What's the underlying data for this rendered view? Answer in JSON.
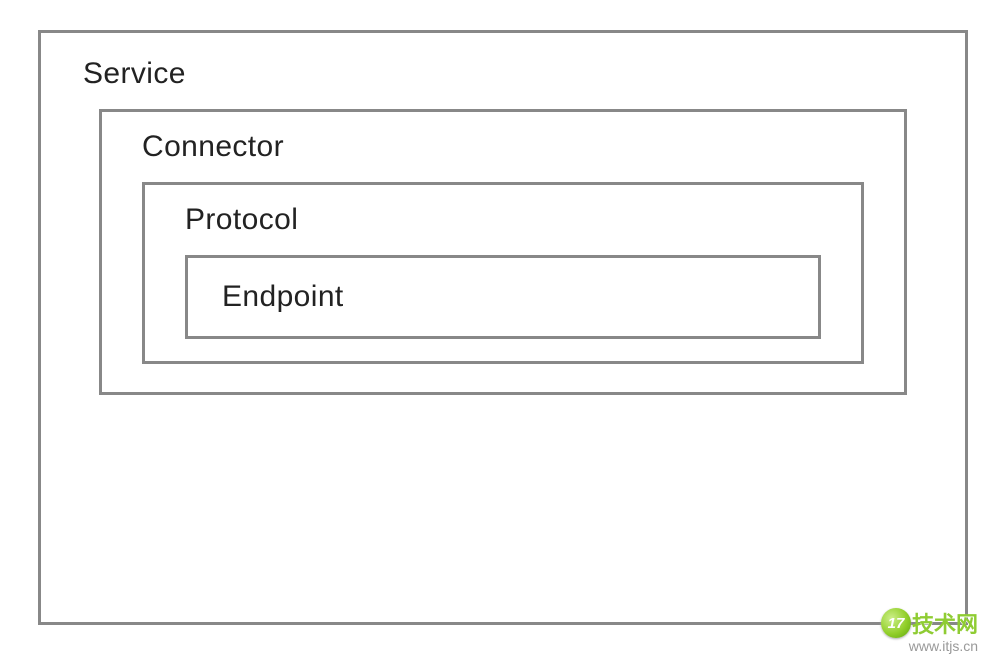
{
  "diagram": {
    "service": {
      "label": "Service"
    },
    "connector": {
      "label": "Connector"
    },
    "protocol": {
      "label": "Protocol"
    },
    "endpoint": {
      "label": "Endpoint"
    }
  },
  "watermark": {
    "badge": "17",
    "brand": "技术网",
    "url": "www.itjs.cn"
  }
}
